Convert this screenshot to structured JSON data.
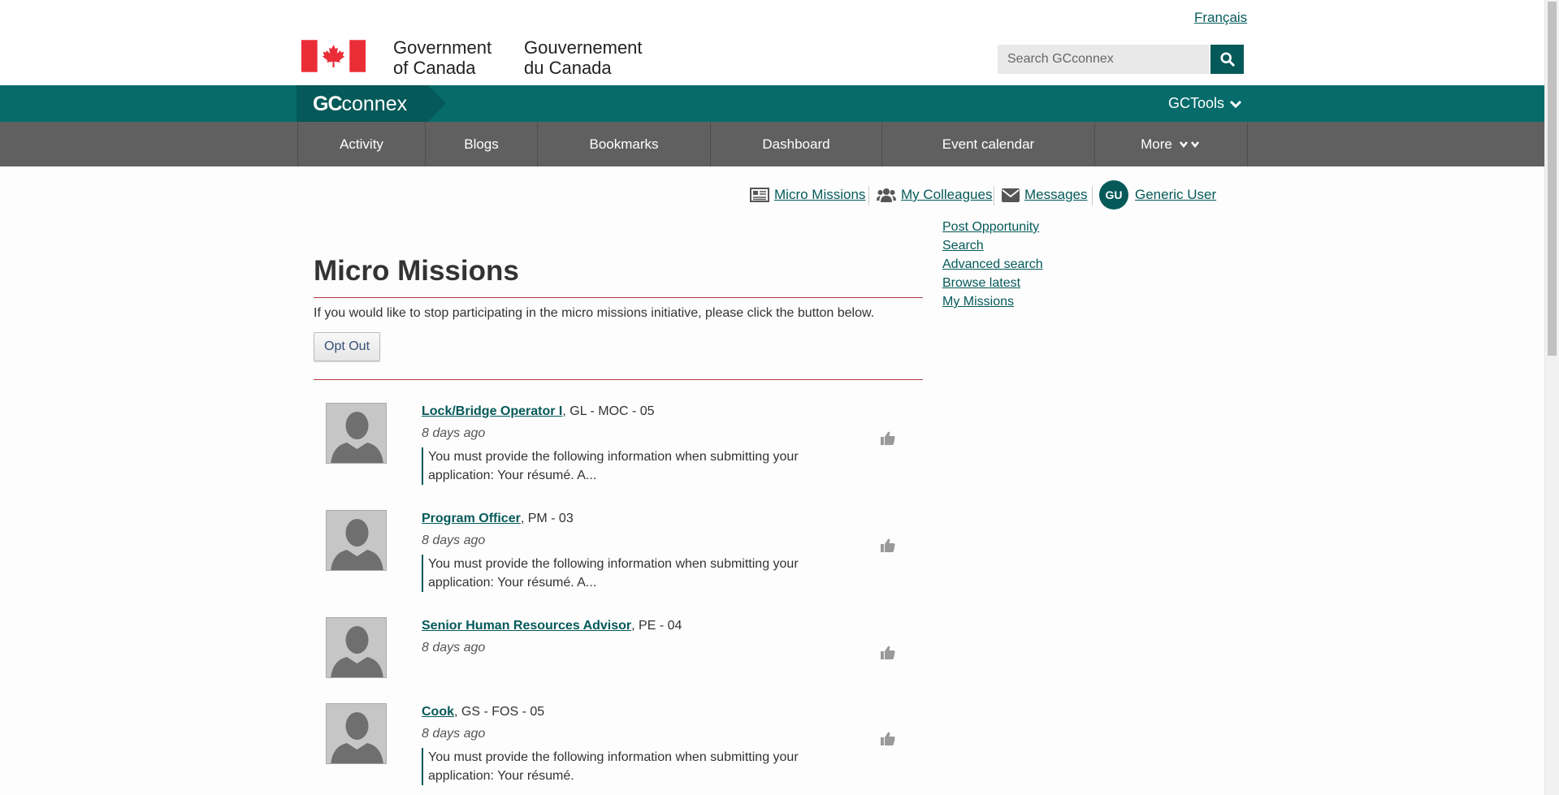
{
  "header": {
    "lang_link": "Français",
    "gov_en_line1": "Government",
    "gov_en_line2": "of Canada",
    "gov_fr_line1": "Gouvernement",
    "gov_fr_line2": "du Canada",
    "search_placeholder": "Search GCconnex"
  },
  "brand": {
    "bold": "GC",
    "light": "connex",
    "tools_label": "GCTools"
  },
  "nav": {
    "items": [
      {
        "label": "Activity"
      },
      {
        "label": "Blogs"
      },
      {
        "label": "Bookmarks"
      },
      {
        "label": "Dashboard"
      },
      {
        "label": "Event calendar"
      },
      {
        "label": "More"
      }
    ]
  },
  "userbar": {
    "micro_missions": "Micro Missions",
    "colleagues": "My Colleagues",
    "messages": "Messages",
    "initials": "GU",
    "user_name": "Generic User"
  },
  "sidebar": {
    "links": [
      "Post Opportunity",
      "Search",
      "Advanced search",
      "Browse latest",
      "My Missions"
    ]
  },
  "main": {
    "title": "Micro Missions",
    "intro": "If you would like to stop participating in the micro missions initiative, please click the button below.",
    "opt_out_label": "Opt Out"
  },
  "missions": [
    {
      "title": "Lock/Bridge Operator I",
      "meta": ", GL - MOC - 05",
      "date": "8 days ago",
      "excerpt": "You must provide the following information when submitting your application: Your résumé. A..."
    },
    {
      "title": "Program Officer",
      "meta": ", PM - 03",
      "date": "8 days ago",
      "excerpt": "You must provide the following information when submitting your application: Your résumé. A..."
    },
    {
      "title": "Senior Human Resources Advisor",
      "meta": ", PE - 04",
      "date": "8 days ago",
      "excerpt": ""
    },
    {
      "title": "Cook",
      "meta": ", GS - FOS - 05",
      "date": "8 days ago",
      "excerpt": "You must provide the following information when submitting your application: Your résumé."
    }
  ],
  "colors": {
    "brand_teal": "#055959",
    "bar_teal": "#076b6b",
    "nav_grey": "#606060",
    "rule_red": "#af3c43"
  },
  "icons": {
    "search": "search-icon",
    "chevron": "chevron-down-icon",
    "thumbs_up": "thumbs-up-icon",
    "flag": "canada-flag-icon"
  }
}
